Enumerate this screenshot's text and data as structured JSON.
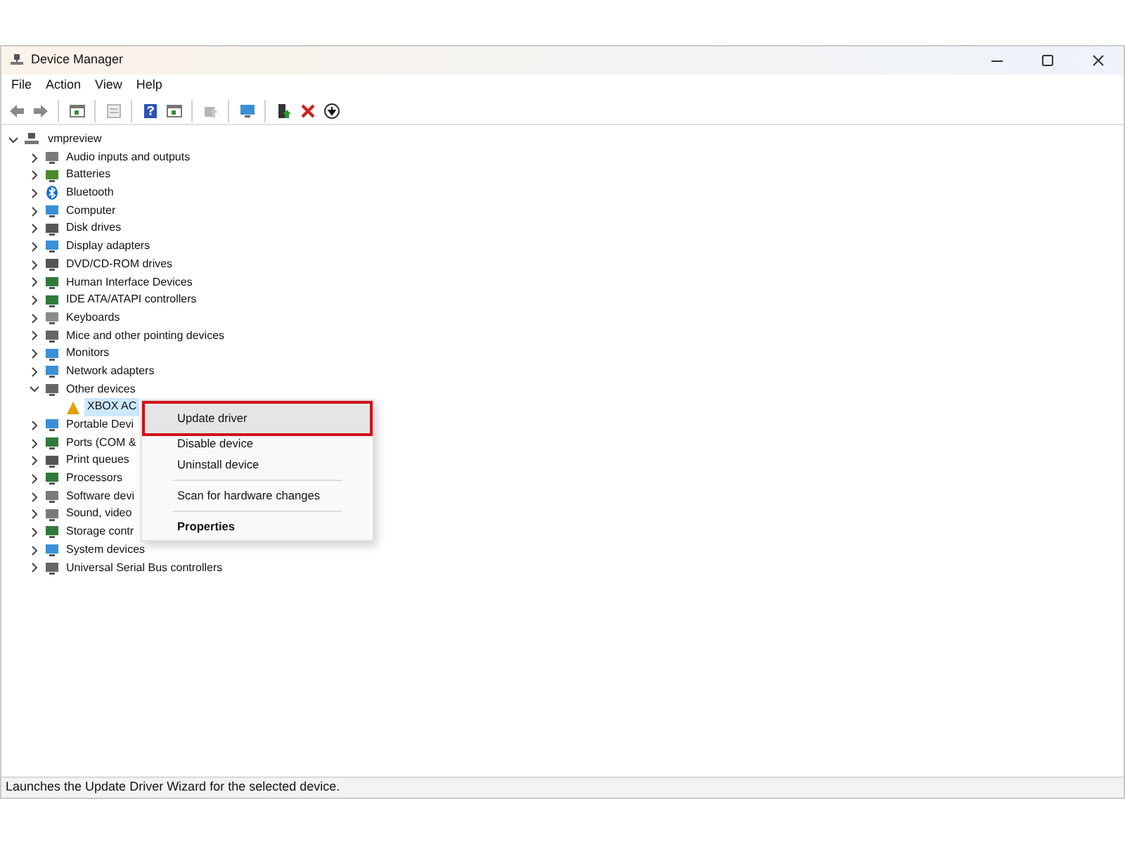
{
  "window": {
    "title": "Device Manager"
  },
  "menu_bar": [
    "File",
    "Action",
    "View",
    "Help"
  ],
  "toolbar": [
    {
      "kind": "back",
      "disabled": false
    },
    {
      "kind": "forward",
      "disabled": false
    },
    {
      "kind": "sep"
    },
    {
      "kind": "pane",
      "disabled": false
    },
    {
      "kind": "sep"
    },
    {
      "kind": "props",
      "disabled": true
    },
    {
      "kind": "sep"
    },
    {
      "kind": "help",
      "disabled": false
    },
    {
      "kind": "pane",
      "disabled": false
    },
    {
      "kind": "sep"
    },
    {
      "kind": "scan",
      "disabled": true
    },
    {
      "kind": "sep"
    },
    {
      "kind": "monitor",
      "disabled": false
    },
    {
      "kind": "sep"
    },
    {
      "kind": "update",
      "disabled": false
    },
    {
      "kind": "remove",
      "disabled": false
    },
    {
      "kind": "download",
      "disabled": false
    }
  ],
  "tree": {
    "label": "vmpreview",
    "expanded": true,
    "children": [
      {
        "label": "Audio inputs and outputs",
        "expanded": false
      },
      {
        "label": "Batteries",
        "expanded": false
      },
      {
        "label": "Bluetooth",
        "expanded": false
      },
      {
        "label": "Computer",
        "expanded": false
      },
      {
        "label": "Disk drives",
        "expanded": false
      },
      {
        "label": "Display adapters",
        "expanded": false
      },
      {
        "label": "DVD/CD-ROM drives",
        "expanded": false
      },
      {
        "label": "Human Interface Devices",
        "expanded": false
      },
      {
        "label": "IDE ATA/ATAPI controllers",
        "expanded": false
      },
      {
        "label": "Keyboards",
        "expanded": false
      },
      {
        "label": "Mice and other pointing devices",
        "expanded": false
      },
      {
        "label": "Monitors",
        "expanded": false
      },
      {
        "label": "Network adapters",
        "expanded": false
      },
      {
        "label": "Other devices",
        "expanded": true,
        "children": [
          {
            "label": "XBOX AC",
            "selected": true
          }
        ]
      },
      {
        "label": "Portable Devi",
        "expanded": false
      },
      {
        "label": "Ports (COM &",
        "expanded": false
      },
      {
        "label": "Print queues",
        "expanded": false
      },
      {
        "label": "Processors",
        "expanded": false
      },
      {
        "label": "Software devi",
        "expanded": false
      },
      {
        "label": "Sound, video",
        "expanded": false
      },
      {
        "label": "Storage contr",
        "expanded": false
      },
      {
        "label": "System devices",
        "expanded": false
      },
      {
        "label": "Universal Serial Bus controllers",
        "expanded": false
      }
    ]
  },
  "context_menu": [
    {
      "kind": "item",
      "label": "Update driver",
      "selected": true
    },
    {
      "kind": "item",
      "label": "Disable device",
      "selected": false
    },
    {
      "kind": "item",
      "label": "Uninstall device",
      "selected": false
    },
    {
      "kind": "separator"
    },
    {
      "kind": "item",
      "label": "Scan for hardware changes",
      "selected": false
    },
    {
      "kind": "separator"
    },
    {
      "kind": "default",
      "label": "Properties",
      "selected": false
    }
  ],
  "status_bar": "Launches the Update Driver Wizard for the selected device."
}
